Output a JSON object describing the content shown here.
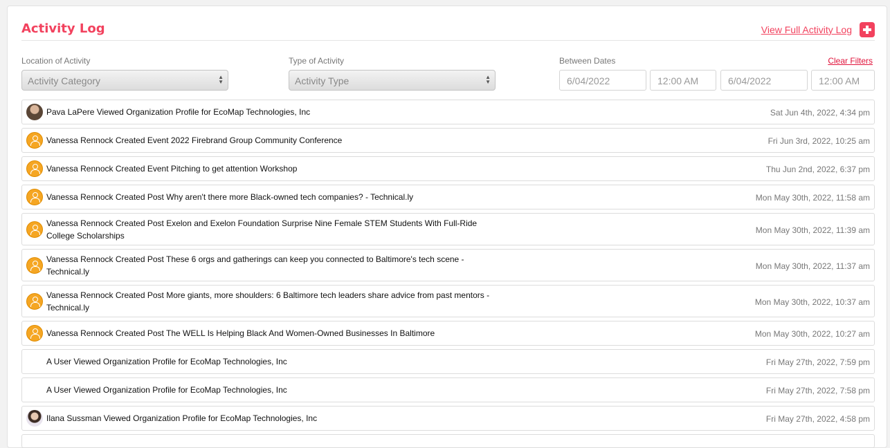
{
  "header": {
    "title": "Activity Log",
    "view_full_link": "View Full Activity Log",
    "add_icon": "plus-icon"
  },
  "filters": {
    "location_label": "Location of Activity",
    "location_value": "Activity Category",
    "type_label": "Type of Activity",
    "type_value": "Activity Type",
    "dates_label": "Between Dates",
    "clear_label": "Clear Filters",
    "start_date": "6/04/2022",
    "start_time": "12:00 AM",
    "end_date": "6/04/2022",
    "end_time": "12:00 AM"
  },
  "activities": [
    {
      "avatar": "photo",
      "text": "Pava LaPere Viewed Organization Profile for EcoMap Technologies, Inc",
      "time": "Sat Jun 4th, 2022, 4:34 pm"
    },
    {
      "avatar": "default",
      "text": "Vanessa Rennock Created Event 2022 Firebrand Group Community Conference",
      "time": "Fri Jun 3rd, 2022, 10:25 am"
    },
    {
      "avatar": "default",
      "text": "Vanessa Rennock Created Event Pitching to get attention Workshop",
      "time": "Thu Jun 2nd, 2022, 6:37 pm"
    },
    {
      "avatar": "default",
      "text": "Vanessa Rennock Created Post Why aren't there more Black-owned tech companies? - Technical.ly",
      "time": "Mon May 30th, 2022, 11:58 am"
    },
    {
      "avatar": "default",
      "text": "Vanessa Rennock Created Post Exelon and Exelon Foundation Surprise Nine Female STEM Students With Full-Ride College Scholarships",
      "time": "Mon May 30th, 2022, 11:39 am"
    },
    {
      "avatar": "default",
      "text": "Vanessa Rennock Created Post These 6 orgs and gatherings can keep you connected to Baltimore's tech scene - Technical.ly",
      "time": "Mon May 30th, 2022, 11:37 am"
    },
    {
      "avatar": "default",
      "text": "Vanessa Rennock Created Post More giants, more shoulders: 6 Baltimore tech leaders share advice from past mentors - Technical.ly",
      "time": "Mon May 30th, 2022, 10:37 am"
    },
    {
      "avatar": "default",
      "text": "Vanessa Rennock Created Post The WELL Is Helping Black And Women-Owned Businesses In Baltimore",
      "time": "Mon May 30th, 2022, 10:27 am"
    },
    {
      "avatar": "none",
      "text": "A User  Viewed Organization Profile for EcoMap Technologies, Inc",
      "time": "Fri May 27th, 2022, 7:59 pm"
    },
    {
      "avatar": "none",
      "text": "A User  Viewed Organization Profile for EcoMap Technologies, Inc",
      "time": "Fri May 27th, 2022, 7:58 pm"
    },
    {
      "avatar": "photo2",
      "text": "Ilana Sussman Viewed Organization Profile for EcoMap Technologies, Inc",
      "time": "Fri May 27th, 2022, 4:58 pm"
    }
  ]
}
